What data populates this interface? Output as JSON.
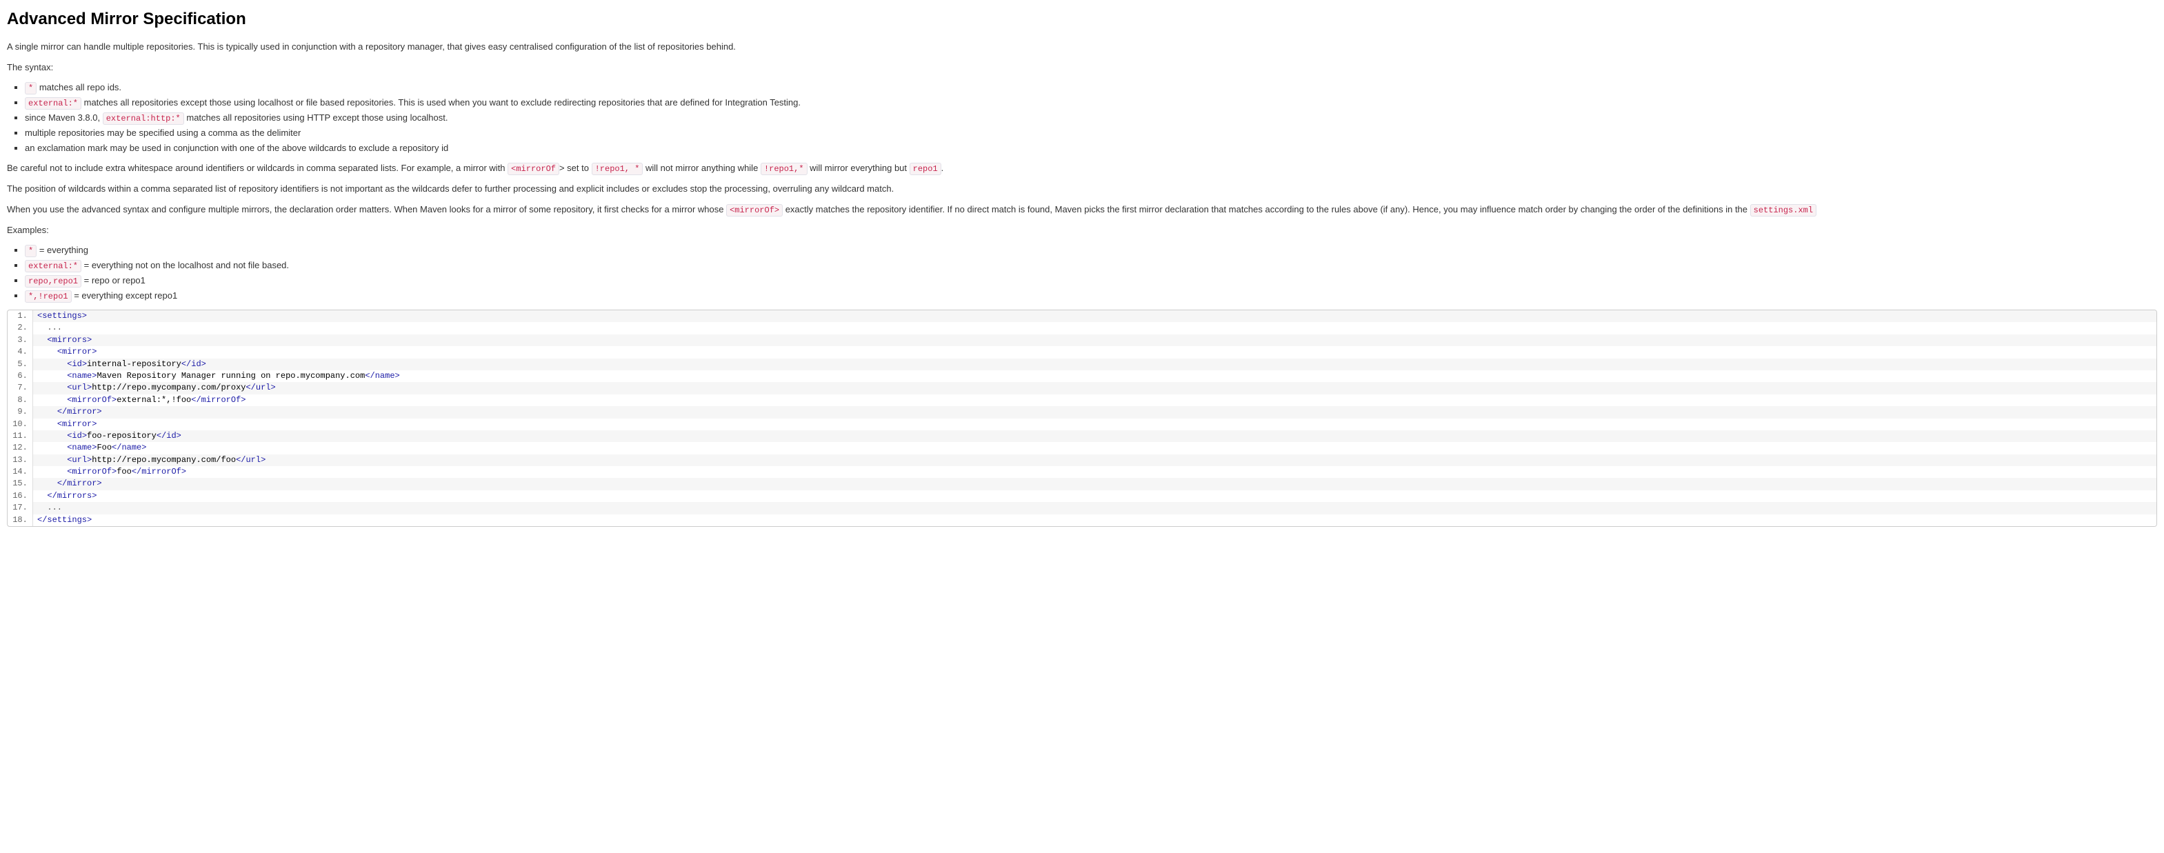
{
  "title": "Advanced Mirror Specification",
  "intro": "A single mirror can handle multiple repositories. This is typically used in conjunction with a repository manager, that gives easy centralised configuration of the list of repositories behind.",
  "syntax_label": "The syntax:",
  "syntax_items": [
    {
      "code": "*",
      "text": " matches all repo ids."
    },
    {
      "code": "external:*",
      "text": " matches all repositories except those using localhost or file based repositories. This is used when you want to exclude redirecting repositories that are defined for Integration Testing."
    },
    {
      "pre": "since Maven 3.8.0, ",
      "code": "external:http:*",
      "text": " matches all repositories using HTTP except those using localhost."
    },
    {
      "text": "multiple repositories may be specified using a comma as the delimiter"
    },
    {
      "text": "an exclamation mark may be used in conjunction with one of the above wildcards to exclude a repository id"
    }
  ],
  "careful": {
    "p1": "Be careful not to include extra whitespace around identifiers or wildcards in comma separated lists. For example, a mirror with ",
    "c1": "<mirrorOf",
    "p2": "> set to ",
    "c2": "!repo1, *",
    "p3": " will not mirror anything while ",
    "c3": "!repo1,*",
    "p4": " will mirror everything but ",
    "c4": "repo1",
    "p5": "."
  },
  "position_text": "The position of wildcards within a comma separated list of repository identifiers is not important as the wildcards defer to further processing and explicit includes or excludes stop the processing, overruling any wildcard match.",
  "advanced": {
    "p1": "When you use the advanced syntax and configure multiple mirrors, the declaration order matters. When Maven looks for a mirror of some repository, it first checks for a mirror whose ",
    "c1": "<mirrorOf>",
    "p2": " exactly matches the repository identifier. If no direct match is found, Maven picks the first mirror declaration that matches according to the rules above (if any). Hence, you may influence match order by changing the order of the definitions in the ",
    "c2": "settings.xml"
  },
  "examples_label": "Examples:",
  "examples": [
    {
      "code": "*",
      "text": " = everything"
    },
    {
      "code": "external:*",
      "text": " = everything not on the localhost and not file based."
    },
    {
      "code": "repo,repo1",
      "text": " = repo or repo1"
    },
    {
      "code": "*,!repo1",
      "text": " = everything except repo1"
    }
  ],
  "code": {
    "tags": {
      "settings_o": "<settings>",
      "settings_c": "</settings>",
      "mirrors_o": "<mirrors>",
      "mirrors_c": "</mirrors>",
      "mirror_o": "<mirror>",
      "mirror_c": "</mirror>",
      "id_o": "<id>",
      "id_c": "</id>",
      "name_o": "<name>",
      "name_c": "</name>",
      "url_o": "<url>",
      "url_c": "</url>",
      "mirrorOf_o": "<mirrorOf>",
      "mirrorOf_c": "</mirrorOf>"
    },
    "vals": {
      "dots": "...",
      "id1": "internal-repository",
      "name1": "Maven Repository Manager running on repo.mycompany.com",
      "url1": "http://repo.mycompany.com/proxy",
      "mirrorOf1": "external:*,!foo",
      "id2": "foo-repository",
      "name2": "Foo",
      "url2": "http://repo.mycompany.com/foo",
      "mirrorOf2": "foo"
    }
  }
}
